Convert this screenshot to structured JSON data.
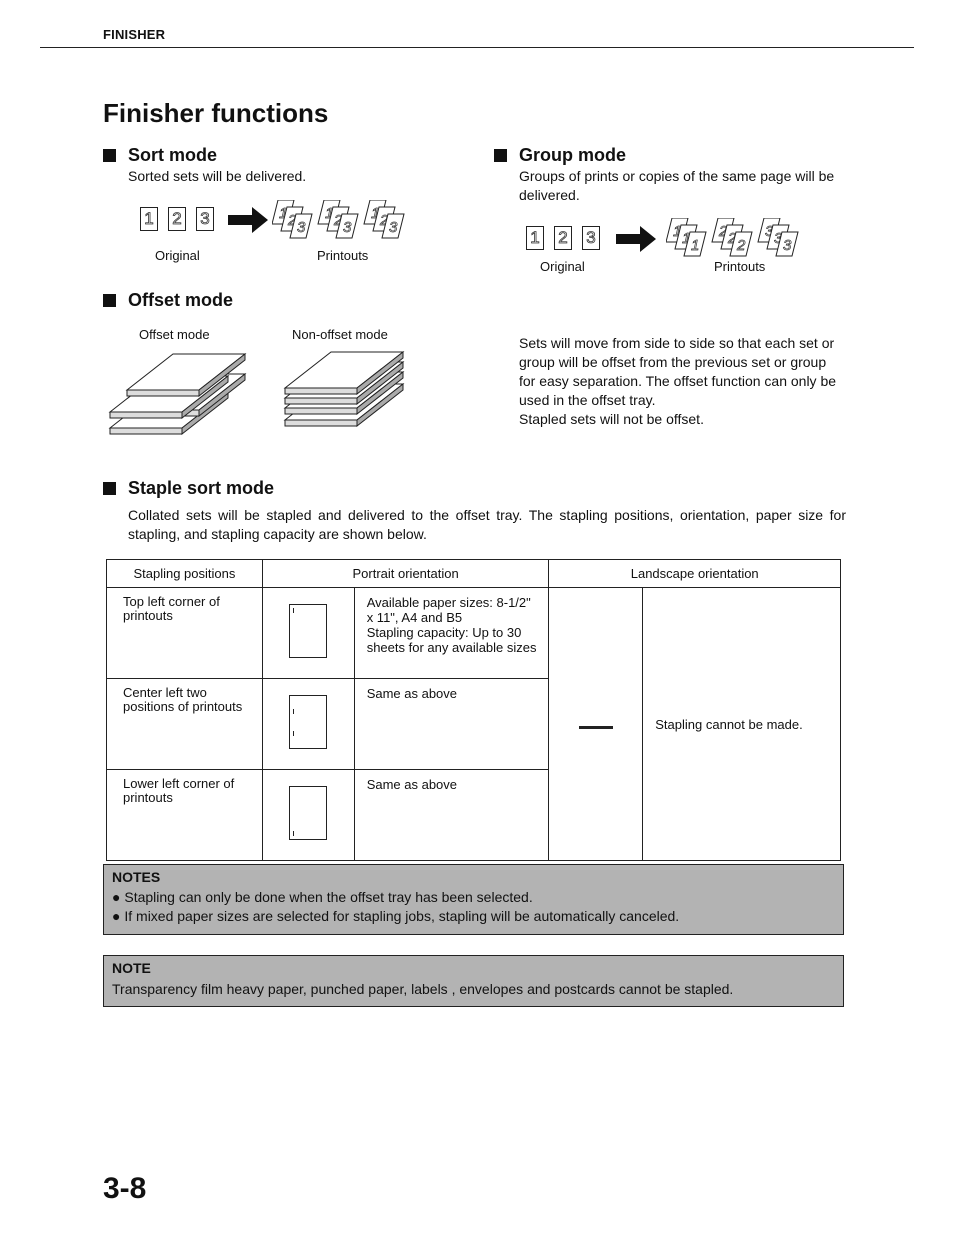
{
  "header": {
    "running_head": "FINISHER"
  },
  "page_title": "Finisher functions",
  "sort_mode": {
    "title": "Sort mode",
    "description": "Sorted sets will be delivered.",
    "figure": {
      "originals": [
        "1",
        "2",
        "3"
      ],
      "original_label": "Original",
      "printouts_label": "Printouts",
      "printout_sets": [
        [
          "1",
          "2",
          "3"
        ],
        [
          "1",
          "2",
          "3"
        ],
        [
          "1",
          "2",
          "3"
        ]
      ]
    }
  },
  "group_mode": {
    "title": "Group mode",
    "description": "Groups of prints or copies of the same page will be delivered.",
    "figure": {
      "originals": [
        "1",
        "2",
        "3"
      ],
      "original_label": "Original",
      "printouts_label": "Printouts",
      "printout_sets": [
        [
          "1",
          "1",
          "1"
        ],
        [
          "2",
          "2",
          "2"
        ],
        [
          "3",
          "3",
          "3"
        ]
      ]
    }
  },
  "offset_mode": {
    "title": "Offset mode",
    "offset_label": "Offset mode",
    "non_offset_label": "Non-offset mode",
    "description_lines": [
      "Sets will move from side to side so that each set or",
      "group will be offset from the previous set or group",
      "for easy separation. The offset function can only be",
      "used in the offset tray.",
      "Stapled sets will not be offset."
    ]
  },
  "staple_sort_mode": {
    "title": "Staple sort mode",
    "description": "Collated sets will be stapled and delivered to the offset tray. The stapling positions, orientation, paper size for stapling, and stapling capacity are shown below.",
    "table": {
      "headers": [
        "Stapling positions",
        "Portrait orientation",
        "Landscape orientation"
      ],
      "rows": [
        {
          "position": "Top left corner of printouts",
          "portrait_text": "Available paper sizes: 8-1/2\" x 11\", A4 and B5\nStapling capacity: Up to 30 sheets for any available sizes"
        },
        {
          "position": "Center left two positions of printouts",
          "portrait_text": "Same as above"
        },
        {
          "position": "Lower left corner of printouts",
          "portrait_text": "Same as above"
        }
      ],
      "landscape_symbol": "—",
      "landscape_text": "Stapling cannot be made."
    }
  },
  "notes": {
    "title": "NOTES",
    "items": [
      "Stapling can only be done when the offset tray has been selected.",
      "If mixed paper sizes are selected for stapling jobs, stapling will be automatically canceled."
    ]
  },
  "note": {
    "title": "NOTE",
    "text": "Transparency film heavy paper, punched paper, labels , envelopes and postcards cannot be stapled."
  },
  "page_number": "3-8",
  "colors": {
    "note_background": "#b3b3b3",
    "text": "#111111"
  }
}
